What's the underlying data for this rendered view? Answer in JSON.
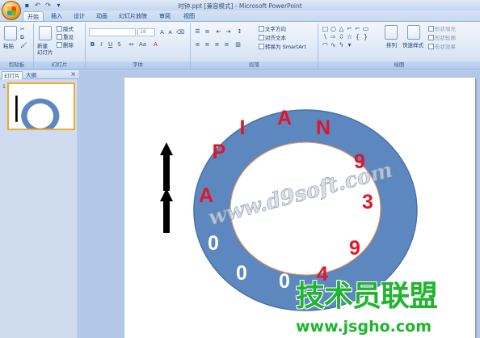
{
  "window": {
    "title": "时钟.ppt [兼容模式] - Microsoft PowerPoint"
  },
  "tabs": [
    {
      "label": "开始",
      "active": true
    },
    {
      "label": "插入",
      "active": false
    },
    {
      "label": "设计",
      "active": false
    },
    {
      "label": "动画",
      "active": false
    },
    {
      "label": "幻灯片放映",
      "active": false
    },
    {
      "label": "审阅",
      "active": false
    },
    {
      "label": "视图",
      "active": false
    }
  ],
  "ribbon": {
    "clipboard": {
      "label": "剪贴板",
      "paste": "粘贴"
    },
    "slides": {
      "label": "幻灯片",
      "new_slide": "新建\n幻灯片",
      "layout": "版式",
      "reset": "重设",
      "delete": "删除"
    },
    "font": {
      "label": "字体",
      "font_size": "18"
    },
    "paragraph": {
      "label": "段落",
      "text_direction": "文字方向",
      "align_text": "对齐文本",
      "smartart": "转换为 SmartArt"
    },
    "drawing": {
      "label": "绘图",
      "arrange": "排列",
      "quick_styles": "快速样式",
      "shape_fill": "形状填充",
      "shape_outline": "形状轮廓",
      "shape_effects": "形状效果"
    }
  },
  "pane": {
    "tab_slides": "幻灯片",
    "tab_outline": "大纲",
    "slide_number": "1"
  },
  "slide": {
    "ring_letters": [
      "A",
      "P",
      "I",
      "A",
      "N",
      "9",
      "3",
      "9",
      "4",
      "0",
      "0",
      "0"
    ],
    "colors": {
      "ring": "#5d87bf",
      "ring_border": "#4a72a8",
      "inner_border": "#e39c6a",
      "letters_red": "#e0162b",
      "letters_white": "#ffffff"
    },
    "watermark": "www.d9soft.com",
    "overlay_brand": "技术员联盟",
    "overlay_url": "www.jsgho.com"
  }
}
